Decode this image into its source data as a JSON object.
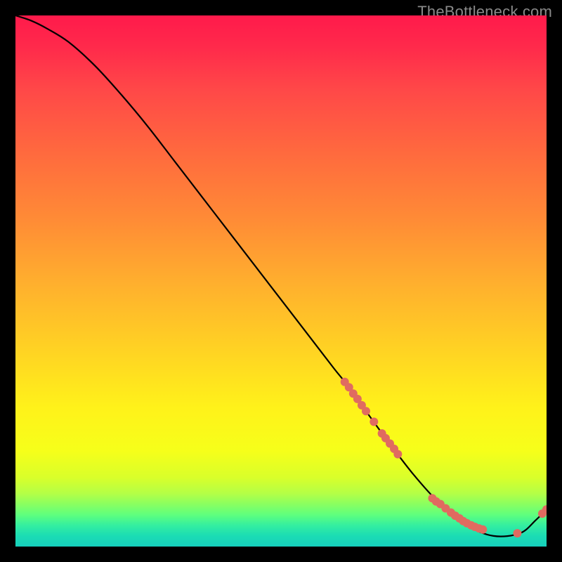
{
  "watermark": "TheBottleneck.com",
  "colors": {
    "background": "#000000",
    "gradient_top": "#ff1a4b",
    "gradient_mid1": "#ff8a36",
    "gradient_mid2": "#fff21a",
    "gradient_bottom": "#16d0bc",
    "curve": "#000000",
    "marker": "#e06b60"
  },
  "chart_data": {
    "type": "line",
    "title": "",
    "xlabel": "",
    "ylabel": "",
    "xlim": [
      0,
      100
    ],
    "ylim": [
      0,
      100
    ],
    "grid": false,
    "legend": false,
    "series": [
      {
        "name": "curve",
        "x": [
          0,
          3,
          6,
          10,
          15,
          20,
          25,
          30,
          35,
          40,
          45,
          50,
          55,
          60,
          62,
          66,
          70,
          75,
          80,
          85,
          90,
          95,
          98,
          100
        ],
        "y": [
          100,
          99,
          97.5,
          95,
          90.5,
          85,
          79,
          72.5,
          66,
          59.5,
          53,
          46.5,
          40,
          33.5,
          31,
          25.5,
          20,
          13.5,
          8,
          4,
          2,
          2.5,
          5,
          7
        ]
      }
    ],
    "markers": [
      {
        "x": 62.0,
        "y": 31.0
      },
      {
        "x": 62.8,
        "y": 30.0
      },
      {
        "x": 63.6,
        "y": 28.8
      },
      {
        "x": 64.4,
        "y": 27.8
      },
      {
        "x": 65.2,
        "y": 26.6
      },
      {
        "x": 66.0,
        "y": 25.5
      },
      {
        "x": 67.5,
        "y": 23.5
      },
      {
        "x": 69.0,
        "y": 21.3
      },
      {
        "x": 69.7,
        "y": 20.4
      },
      {
        "x": 70.5,
        "y": 19.4
      },
      {
        "x": 71.3,
        "y": 18.4
      },
      {
        "x": 72.0,
        "y": 17.4
      },
      {
        "x": 78.5,
        "y": 9.1
      },
      {
        "x": 79.2,
        "y": 8.5
      },
      {
        "x": 80.0,
        "y": 8.0
      },
      {
        "x": 81.0,
        "y": 7.2
      },
      {
        "x": 82.0,
        "y": 6.4
      },
      {
        "x": 82.8,
        "y": 5.8
      },
      {
        "x": 83.6,
        "y": 5.3
      },
      {
        "x": 84.3,
        "y": 4.8
      },
      {
        "x": 85.0,
        "y": 4.4
      },
      {
        "x": 85.8,
        "y": 4.0
      },
      {
        "x": 86.5,
        "y": 3.7
      },
      {
        "x": 87.3,
        "y": 3.4
      },
      {
        "x": 88.0,
        "y": 3.2
      },
      {
        "x": 94.5,
        "y": 2.5
      },
      {
        "x": 99.2,
        "y": 6.2
      },
      {
        "x": 100.0,
        "y": 7.0
      }
    ]
  }
}
